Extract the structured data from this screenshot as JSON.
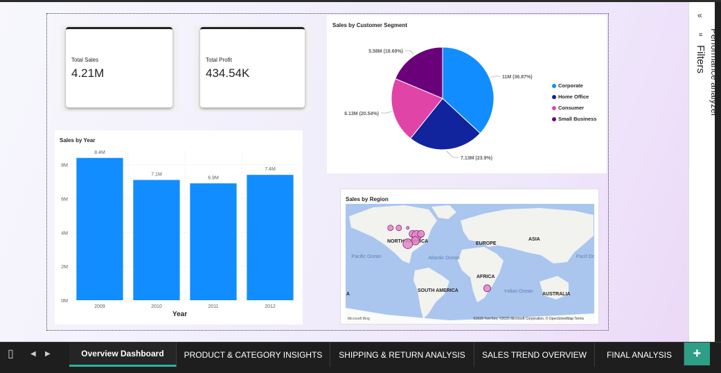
{
  "cards": [
    {
      "label": "Total Sales",
      "value": "4.21M"
    },
    {
      "label": "Total Profit",
      "value": "434.54K"
    }
  ],
  "bar_chart": {
    "title": "Sales by Year",
    "xlabel": "Year"
  },
  "pie_chart": {
    "title": "Sales by Customer Segment"
  },
  "map": {
    "title": "Sales by Region",
    "labels": {
      "north_america": "NORTH AMERICA",
      "europe": "EUROPE",
      "asia": "ASIA",
      "africa": "AFRICA",
      "south_america": "SOUTH AMERICA",
      "australia": "AUSTRALIA",
      "pacific_ocean": "Pacific Ocean",
      "atlantic_ocean": "Atlantic Ocean",
      "indian_ocean": "Indian Ocean",
      "pacific_ocean_right": "Pacif Ocea",
      "left_letter": "A"
    },
    "attribution": "©2025 TomTom, ©2025 Microsoft Corporation, © OpenStreetMap  Terms",
    "provider": "Microsoft Bing",
    "bubbles": [
      {
        "lon": -120,
        "lat": 50,
        "r": 4
      },
      {
        "lon": -108,
        "lat": 50,
        "r": 4
      },
      {
        "lon": -95,
        "lat": 50,
        "r": 2
      },
      {
        "lon": -88,
        "lat": 42,
        "r": 5
      },
      {
        "lon": -82,
        "lat": 40,
        "r": 7
      },
      {
        "lon": -76,
        "lat": 42,
        "r": 5
      },
      {
        "lon": -84,
        "lat": 33,
        "r": 6
      },
      {
        "lon": -95,
        "lat": 29,
        "r": 7
      },
      {
        "lon": 20,
        "lat": -30,
        "r": 5
      }
    ]
  },
  "filters": {
    "label": "Filters",
    "pane2": "Performance analyzer"
  },
  "tabs": [
    {
      "label": "Overview Dashboard",
      "active": true
    },
    {
      "label": "PRODUCT & CATEGORY INSIGHTS",
      "active": false
    },
    {
      "label": "SHIPPING & RETURN ANALYSIS",
      "active": false
    },
    {
      "label": "SALES TREND OVERVIEW",
      "active": false
    },
    {
      "label": "FINAL ANALYSIS",
      "active": false
    }
  ],
  "icons": {
    "device": "phone-icon",
    "prev": "prev-page-icon",
    "next": "next-page-icon",
    "add": "plus-icon",
    "collapse": "double-chevron-icon"
  },
  "colors": {
    "bar": "#118DFF",
    "tab_accent": "#2ab59c",
    "add_button": "#2f9e86"
  },
  "chart_data": [
    {
      "type": "bar",
      "title": "Sales by Year",
      "xlabel": "Year",
      "ylabel": "",
      "categories": [
        "2009",
        "2010",
        "2011",
        "2012"
      ],
      "values": [
        8.4,
        7.1,
        6.9,
        7.4
      ],
      "data_labels": [
        "8.4M",
        "7.1M",
        "6.9M",
        "7.4M"
      ],
      "yticks": [
        "0M",
        "2M",
        "4M",
        "6M",
        "8M"
      ],
      "ylim": [
        0,
        8.8
      ],
      "color": "#118DFF"
    },
    {
      "type": "pie",
      "title": "Sales by Customer Segment",
      "categories": [
        "Corporate",
        "Home Office",
        "Consumer",
        "Small Business"
      ],
      "values": [
        36.87,
        23.9,
        20.54,
        18.69
      ],
      "data_labels": [
        "11M (36.87%)",
        "7.13M (23.9%)",
        "6.13M (20.54%)",
        "5.58M (18.69%)"
      ],
      "colors": [
        "#118DFF",
        "#12239E",
        "#E044A7",
        "#6B007B"
      ],
      "legend": "right"
    }
  ]
}
